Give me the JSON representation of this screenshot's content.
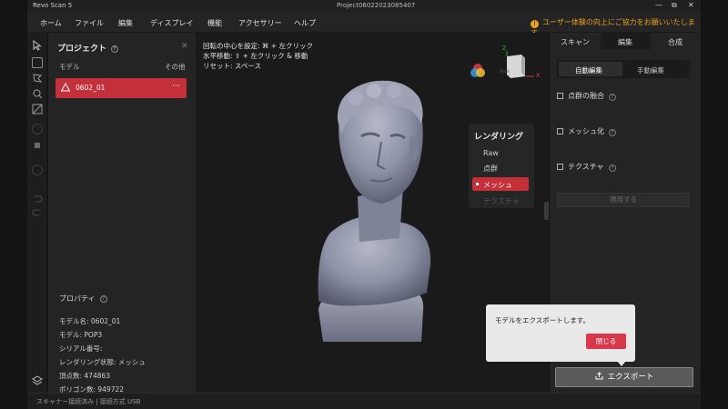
{
  "window": {
    "app_name": "Revo Scan 5",
    "project_name": "Project06022023085407",
    "minimize": "—",
    "maximize": "⧉",
    "close": "✕"
  },
  "menu": [
    "ホーム",
    "ファイル",
    "編集",
    "ディスプレイ",
    "機能",
    "アクセサリー",
    "ヘルプ"
  ],
  "notice": "ユーザー体験の向上にご協力をお願いいたします。",
  "project_panel": {
    "title": "プロジェクト",
    "close": "✕",
    "model_header": "モデル",
    "others": "その他",
    "model_name": "0602_01",
    "more": "···",
    "properties_title": "プロパティ",
    "properties": [
      "モデル名:  0602_01",
      "モデル:  POP3",
      "シリアル番号:",
      "レンダリング状態:  メッシュ",
      "頂点数:  474863",
      "ポリゴン数:  949722"
    ]
  },
  "viewport": {
    "hints": [
      "回転の中心を設定: ⌘ + 左クリック",
      "水平移動: ⇧ + 左クリック & 移動",
      "リセット: スペース"
    ],
    "axis_z": "Z",
    "axis_x": "X",
    "view_cube_label": "BACK"
  },
  "render_panel": {
    "title": "レンダリング",
    "items": [
      "Raw",
      "点群",
      "メッシュ",
      "テクスチャ"
    ],
    "selected": "メッシュ"
  },
  "right_panel": {
    "tabs": [
      "スキャン",
      "編集",
      "合成"
    ],
    "subtabs": [
      "自動編集",
      "手動編集"
    ],
    "options": [
      "点群の融合",
      "メッシュ化",
      "テクスチャ"
    ],
    "apply": "適用する",
    "export": "エクスポート"
  },
  "popup": {
    "message": "モデルをエクスポートします。",
    "close": "閉じる"
  },
  "status": "スキャナー接続済み | 接続方式 USB",
  "colors": {
    "accent_red": "#c4303a",
    "notice_orange": "#e8a020",
    "panel_bg": "#242424",
    "viewport_bg": "#1a1a1a"
  }
}
